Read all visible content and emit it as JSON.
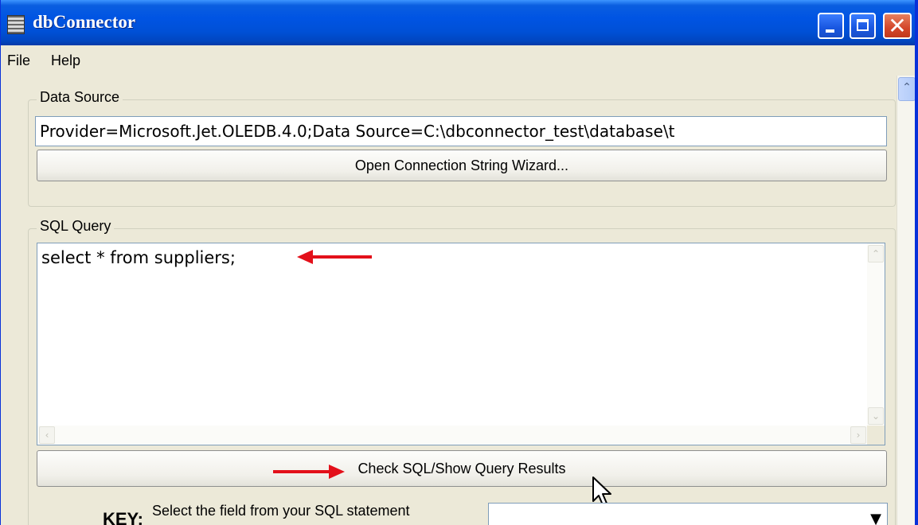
{
  "window": {
    "title": "dbConnector"
  },
  "titlebar": {
    "close_glyph": "✕"
  },
  "menu": {
    "file": "File",
    "help": "Help"
  },
  "data_source": {
    "group_label": "Data Source",
    "connection_string": "Provider=Microsoft.Jet.OLEDB.4.0;Data Source=C:\\dbconnector_test\\database\\t",
    "wizard_button": "Open Connection String Wizard..."
  },
  "sql_query": {
    "group_label": "SQL Query",
    "text": "select * from suppliers;",
    "check_button": "Check SQL/Show Query Results"
  },
  "key": {
    "label": "KEY:",
    "description": "Select the field from your SQL statement",
    "selected": ""
  },
  "scroll_glyphs": {
    "up": "⌃",
    "down": "⌄",
    "left": "‹",
    "right": "›",
    "dropdown": "▼"
  },
  "colors": {
    "annotation_arrow": "#e3101a",
    "titlebar": "#0054e3"
  }
}
